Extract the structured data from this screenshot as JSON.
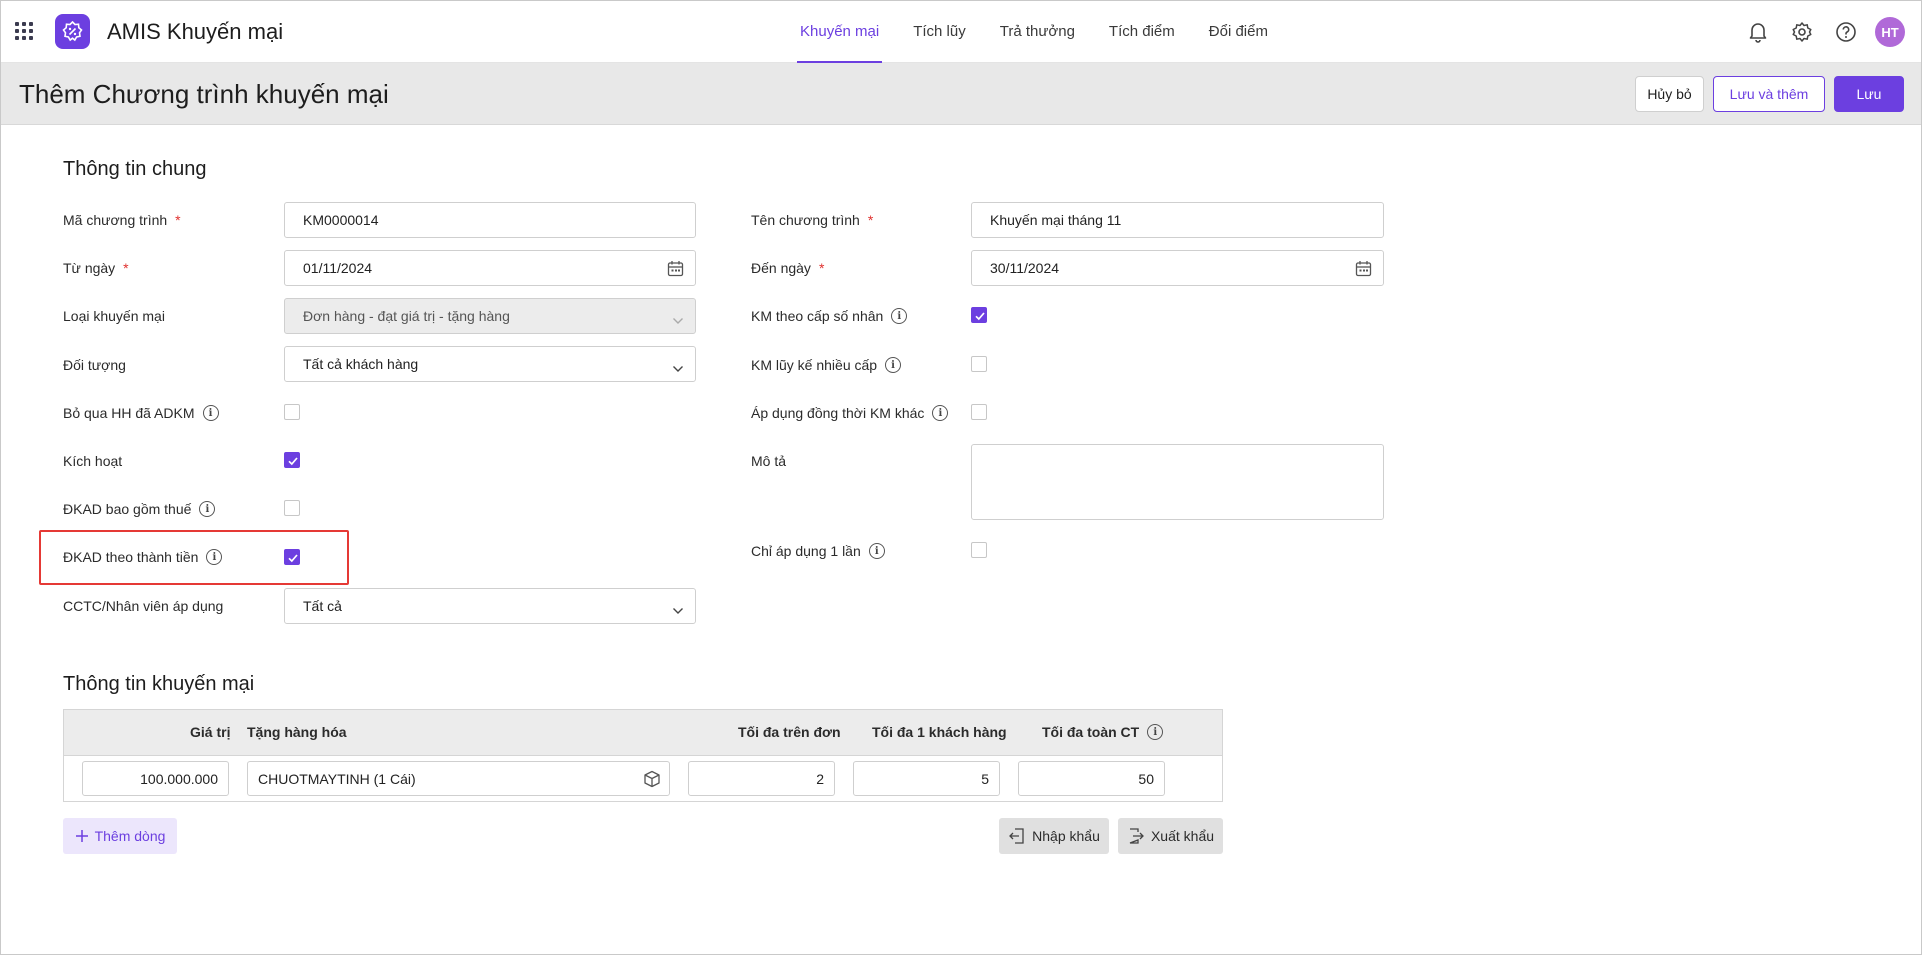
{
  "app": {
    "title": "AMIS Khuyến mại",
    "avatar_initials": "HT"
  },
  "nav": [
    {
      "label": "Khuyến mại",
      "active": true
    },
    {
      "label": "Tích lũy",
      "active": false
    },
    {
      "label": "Trả thưởng",
      "active": false
    },
    {
      "label": "Tích điểm",
      "active": false
    },
    {
      "label": "Đổi điểm",
      "active": false
    }
  ],
  "page": {
    "title": "Thêm Chương trình khuyến mại",
    "cancel_label": "Hủy bỏ",
    "save_add_label": "Lưu và thêm",
    "save_label": "Lưu"
  },
  "general": {
    "section_title": "Thông tin chung",
    "code": {
      "label": "Mã chương trình",
      "value": "KM0000014"
    },
    "name": {
      "label": "Tên chương trình",
      "value": "Khuyến mại tháng 11"
    },
    "from_date": {
      "label": "Từ ngày",
      "value": "01/11/2024"
    },
    "to_date": {
      "label": "Đến ngày",
      "value": "30/11/2024"
    },
    "promo_type": {
      "label": "Loại khuyến mại",
      "value": "Đơn hàng - đạt giá trị - tặng hàng"
    },
    "multiplier": {
      "label": "KM theo cấp số nhân",
      "checked": true
    },
    "target": {
      "label": "Đối tượng",
      "value": "Tất cả khách hàng"
    },
    "cumulative": {
      "label": "KM lũy kế nhiều cấp",
      "checked": false
    },
    "skip_adkm": {
      "label": "Bỏ qua HH đã ADKM",
      "checked": false
    },
    "concurrent": {
      "label": "Áp dụng đồng thời KM khác",
      "checked": false
    },
    "active": {
      "label": "Kích hoạt",
      "checked": true
    },
    "description": {
      "label": "Mô tả",
      "value": ""
    },
    "tax_included": {
      "label": "ĐKAD bao gồm thuế",
      "checked": false
    },
    "by_amount": {
      "label": "ĐKAD theo thành tiền",
      "checked": true
    },
    "apply_once": {
      "label": "Chỉ áp dụng 1 lần",
      "checked": false
    },
    "org_unit": {
      "label": "CCTC/Nhân viên áp dụng",
      "value": "Tất cả"
    }
  },
  "promo": {
    "section_title": "Thông tin khuyến mại",
    "columns": {
      "value": "Giá trị",
      "gift": "Tặng hàng hóa",
      "max_per_order": "Tối đa trên đơn",
      "max_per_customer": "Tối đa 1 khách hàng",
      "max_total": "Tối đa toàn CT"
    },
    "rows": [
      {
        "value": "100.000.000",
        "gift": "CHUOTMAYTINH (1 Cái)",
        "max_per_order": "2",
        "max_per_customer": "5",
        "max_total": "50"
      }
    ],
    "add_row_label": "Thêm dòng",
    "import_label": "Nhập khẩu",
    "export_label": "Xuất khẩu"
  },
  "colors": {
    "accent": "#6c3fe0",
    "required": "#e0302e",
    "highlight": "#e53935"
  }
}
